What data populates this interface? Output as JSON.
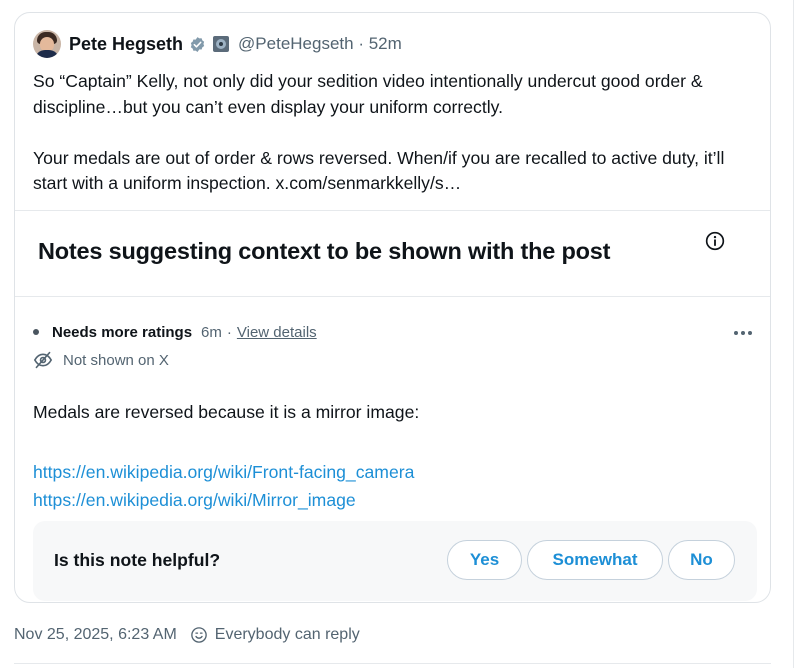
{
  "post": {
    "author_name": "Pete Hegseth",
    "handle_time": "@PeteHegseth · 52m",
    "paragraph1": "So “Captain” Kelly, not only did your sedition video intentionally undercut good order & discipline…but you can’t even display your uniform correctly.",
    "paragraph2": "Your medals are out of order & rows reversed. When/if you are recalled to active duty, it’ll start with a uniform inspection. x.com/senmarkkelly/s…"
  },
  "notes": {
    "title": "Notes suggesting context to be shown with the post",
    "info_icon": "info-icon"
  },
  "note": {
    "status": "Needs more ratings",
    "time": "6m",
    "separator": "·",
    "view_details": "View details",
    "not_shown": "Not shown on X",
    "text": "Medals are reversed because it is a mirror image:",
    "links": [
      "https://en.wikipedia.org/wiki/Front-facing_camera",
      "https://en.wikipedia.org/wiki/Mirror_image"
    ]
  },
  "helpful": {
    "question": "Is this note helpful?",
    "yes": "Yes",
    "somewhat": "Somewhat",
    "no": "No"
  },
  "footer": {
    "timestamp": "Nov 25, 2025, 6:23 AM",
    "reply_setting": "Everybody can reply"
  },
  "colors": {
    "link": "#1d8fd6",
    "secondary_text": "#536471",
    "border": "#dfe3e7",
    "verified_badge": "#829aab"
  }
}
